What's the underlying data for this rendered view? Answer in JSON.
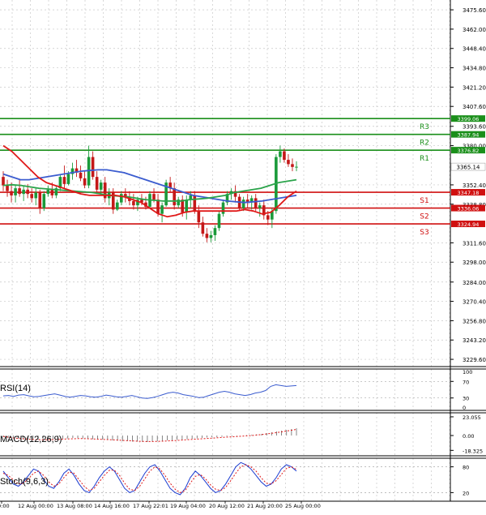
{
  "chart_data": {
    "type": "candlestick",
    "instrument_note": "",
    "main": {
      "ylim": [
        3224.5,
        3482.5
      ],
      "yticks": [
        3475.6,
        3462.0,
        3448.4,
        3434.8,
        3421.2,
        3407.6,
        3393.6,
        3380.0,
        3352.4,
        3338.8,
        3311.6,
        3298.0,
        3284.0,
        3270.4,
        3256.8,
        3243.2,
        3229.6
      ],
      "ytick_labels": [
        "3475.60",
        "3462.00",
        "3448.40",
        "3434.80",
        "3421.20",
        "3407.60",
        "3393.60",
        "3380.00",
        "3352.40",
        "3338.80",
        "3311.60",
        "3298.00",
        "3284.00",
        "3270.40",
        "3256.80",
        "3243.20",
        "3229.60"
      ],
      "levels": [
        {
          "name": "R3",
          "value": 3399.06,
          "label": "3399.06",
          "color": "#1a8f1a"
        },
        {
          "name": "R2",
          "value": 3387.94,
          "label": "3387.94",
          "color": "#1a8f1a"
        },
        {
          "name": "R1",
          "value": 3376.82,
          "label": "3376.82",
          "color": "#1a8f1a"
        },
        {
          "name": "S1",
          "value": 3347.18,
          "label": "3347.18",
          "color": "#d01010"
        },
        {
          "name": "S2",
          "value": 3336.06,
          "label": "3336.06",
          "color": "#d01010"
        },
        {
          "name": "S3",
          "value": 3324.94,
          "label": "3324.94",
          "color": "#d01010"
        }
      ],
      "last_price": {
        "value": 3365.14,
        "label": "3365.14"
      },
      "candles": [
        [
          3358,
          3362,
          3348,
          3352
        ],
        [
          3352,
          3356,
          3344,
          3348
        ],
        [
          3348,
          3354,
          3340,
          3345
        ],
        [
          3345,
          3352,
          3340,
          3350
        ],
        [
          3350,
          3356,
          3344,
          3346
        ],
        [
          3346,
          3352,
          3341,
          3349
        ],
        [
          3349,
          3353,
          3343,
          3346
        ],
        [
          3346,
          3350,
          3340,
          3343
        ],
        [
          3343,
          3350,
          3338,
          3347
        ],
        [
          3347,
          3349,
          3332,
          3336
        ],
        [
          3336,
          3348,
          3334,
          3346
        ],
        [
          3346,
          3352,
          3344,
          3349
        ],
        [
          3349,
          3354,
          3343,
          3345
        ],
        [
          3345,
          3352,
          3343,
          3350
        ],
        [
          3350,
          3360,
          3348,
          3358
        ],
        [
          3358,
          3366,
          3350,
          3353
        ],
        [
          3353,
          3362,
          3352,
          3360
        ],
        [
          3360,
          3368,
          3356,
          3364
        ],
        [
          3364,
          3370,
          3358,
          3361
        ],
        [
          3361,
          3366,
          3355,
          3357
        ],
        [
          3357,
          3362,
          3350,
          3352
        ],
        [
          3352,
          3380,
          3350,
          3372
        ],
        [
          3372,
          3376,
          3356,
          3358
        ],
        [
          3358,
          3362,
          3346,
          3349
        ],
        [
          3349,
          3356,
          3346,
          3354
        ],
        [
          3354,
          3358,
          3340,
          3343
        ],
        [
          3343,
          3350,
          3338,
          3347
        ],
        [
          3347,
          3350,
          3332,
          3335
        ],
        [
          3335,
          3342,
          3334,
          3340
        ],
        [
          3340,
          3348,
          3338,
          3346
        ],
        [
          3346,
          3350,
          3340,
          3344
        ],
        [
          3344,
          3348,
          3338,
          3341
        ],
        [
          3341,
          3346,
          3335,
          3338
        ],
        [
          3338,
          3344,
          3334,
          3342
        ],
        [
          3342,
          3346,
          3338,
          3340
        ],
        [
          3340,
          3344,
          3335,
          3337
        ],
        [
          3337,
          3348,
          3336,
          3346
        ],
        [
          3346,
          3350,
          3340,
          3342
        ],
        [
          3342,
          3346,
          3330,
          3332
        ],
        [
          3332,
          3340,
          3326,
          3338
        ],
        [
          3338,
          3356,
          3337,
          3354
        ],
        [
          3354,
          3358,
          3347,
          3350
        ],
        [
          3350,
          3354,
          3335,
          3338
        ],
        [
          3338,
          3344,
          3336,
          3342
        ],
        [
          3342,
          3345,
          3330,
          3333
        ],
        [
          3333,
          3345,
          3328,
          3342
        ],
        [
          3342,
          3348,
          3336,
          3345
        ],
        [
          3345,
          3348,
          3332,
          3334
        ],
        [
          3334,
          3338,
          3322,
          3326
        ],
        [
          3326,
          3330,
          3316,
          3318
        ],
        [
          3318,
          3322,
          3312,
          3315
        ],
        [
          3315,
          3320,
          3312,
          3317
        ],
        [
          3317,
          3324,
          3313,
          3322
        ],
        [
          3322,
          3334,
          3320,
          3332
        ],
        [
          3332,
          3342,
          3330,
          3340
        ],
        [
          3340,
          3348,
          3338,
          3346
        ],
        [
          3346,
          3350,
          3342,
          3348
        ],
        [
          3348,
          3352,
          3340,
          3344
        ],
        [
          3344,
          3346,
          3334,
          3336
        ],
        [
          3336,
          3344,
          3334,
          3342
        ],
        [
          3342,
          3346,
          3336,
          3340
        ],
        [
          3340,
          3345,
          3335,
          3343
        ],
        [
          3343,
          3346,
          3334,
          3336
        ],
        [
          3336,
          3340,
          3330,
          3338
        ],
        [
          3338,
          3342,
          3328,
          3331
        ],
        [
          3331,
          3334,
          3324,
          3328
        ],
        [
          3328,
          3336,
          3322,
          3334
        ],
        [
          3334,
          3374,
          3332,
          3372
        ],
        [
          3372,
          3380,
          3368,
          3376
        ],
        [
          3376,
          3378,
          3368,
          3370
        ],
        [
          3370,
          3374,
          3365,
          3367
        ],
        [
          3367,
          3371,
          3362,
          3365
        ],
        [
          3365,
          3369,
          3362,
          3365.14
        ]
      ],
      "ma_blue": [
        3360,
        3358,
        3356,
        3356,
        3357,
        3358,
        3359,
        3360,
        3361,
        3362,
        3362.5,
        3363,
        3363,
        3362,
        3361,
        3359,
        3357,
        3355,
        3353,
        3351,
        3349,
        3347,
        3345,
        3344,
        3343,
        3342,
        3341,
        3340.5,
        3340,
        3340.5,
        3341,
        3342,
        3343,
        3344,
        3345
      ],
      "ma_green": [
        3352,
        3352.5,
        3352,
        3351,
        3350,
        3349.5,
        3349,
        3348.5,
        3348,
        3347.5,
        3347,
        3346,
        3345,
        3344.5,
        3344,
        3343,
        3342,
        3341.5,
        3341,
        3341,
        3341,
        3342,
        3342.5,
        3343,
        3344,
        3345,
        3347,
        3348,
        3349,
        3350,
        3352,
        3354,
        3355,
        3356
      ],
      "ma_red": [
        3380,
        3376,
        3370,
        3364,
        3358,
        3354,
        3352,
        3350,
        3348,
        3346,
        3345,
        3345,
        3345,
        3345,
        3344,
        3342,
        3340,
        3336,
        3332,
        3330,
        3331,
        3333,
        3334,
        3334,
        3334,
        3334,
        3334,
        3334,
        3335,
        3334,
        3332,
        3333,
        3338,
        3344,
        3348
      ]
    },
    "xaxis_labels": [
      "0:00",
      "12 Aug 00:00",
      "13 Aug 08:00",
      "14 Aug 16:00",
      "17 Aug 22:01",
      "19 Aug 04:00",
      "20 Aug 12:00",
      "21 Aug 20:00",
      "25 Aug 00:00"
    ],
    "rsi": {
      "label": "RSI(14)",
      "yticks": [
        100,
        70,
        30,
        0
      ],
      "ytick_labels": [
        "100",
        "70",
        "30",
        "0"
      ],
      "values": [
        35,
        36,
        34,
        37,
        38,
        35,
        33,
        34,
        36,
        38,
        40,
        37,
        34,
        32,
        34,
        36,
        35,
        33,
        32,
        34,
        37,
        35,
        33,
        32,
        34,
        36,
        33,
        30,
        29,
        31,
        34,
        38,
        42,
        44,
        42,
        38,
        36,
        34,
        31,
        32,
        36,
        40,
        44,
        46,
        44,
        40,
        38,
        36,
        38,
        42,
        44,
        48,
        58,
        62,
        60,
        58,
        59,
        60
      ]
    },
    "macd": {
      "label": "MACD(12,26,9)",
      "yticks": [
        23.055,
        0.0,
        -18.325
      ],
      "ytick_labels": [
        "23.055",
        "0.00",
        "-18.325"
      ],
      "hist": [
        -2,
        -3,
        -3.5,
        -4,
        -4.5,
        -5,
        -5,
        -5.5,
        -5.5,
        -5,
        -4.5,
        -4,
        -4,
        -3.5,
        -3,
        -3,
        -3.5,
        -4,
        -4.5,
        -5,
        -5,
        -5.5,
        -6,
        -6.5,
        -7,
        -7,
        -7.5,
        -7.5,
        -8,
        -8,
        -7.5,
        -7,
        -6.5,
        -6,
        -6,
        -5.5,
        -5,
        -4.5,
        -4,
        -3.5,
        -3,
        -2.5,
        -2,
        -2,
        -1.5,
        -1,
        -1,
        -0.5,
        0,
        0.5,
        1,
        1.5,
        2,
        3,
        4,
        5,
        6,
        7,
        8,
        9
      ],
      "signal": [
        -1,
        -2,
        -3,
        -3.5,
        -4,
        -4.5,
        -5,
        -5,
        -5.2,
        -5.2,
        -5,
        -4.8,
        -4.5,
        -4.2,
        -4,
        -3.8,
        -3.8,
        -4,
        -4.2,
        -4.5,
        -4.8,
        -5,
        -5.3,
        -5.6,
        -6,
        -6.3,
        -6.6,
        -7,
        -7.2,
        -7.4,
        -7.4,
        -7.2,
        -7,
        -6.7,
        -6.4,
        -6,
        -5.6,
        -5.2,
        -4.8,
        -4.4,
        -4,
        -3.6,
        -3.2,
        -2.8,
        -2.4,
        -2,
        -1.6,
        -1.2,
        -0.8,
        -0.4,
        0,
        0.6,
        1.2,
        2,
        2.8,
        3.6,
        4.5,
        5.5,
        6.5,
        7.5
      ]
    },
    "stoch": {
      "label": "Stoch(9,6,3)",
      "yticks": [
        80,
        20
      ],
      "ytick_labels": [
        "80",
        "20"
      ],
      "k": [
        70,
        55,
        40,
        35,
        45,
        60,
        75,
        70,
        50,
        35,
        30,
        45,
        65,
        75,
        60,
        40,
        25,
        20,
        35,
        55,
        70,
        80,
        70,
        50,
        30,
        20,
        25,
        45,
        65,
        80,
        85,
        70,
        50,
        30,
        20,
        15,
        30,
        55,
        70,
        60,
        45,
        30,
        20,
        25,
        40,
        60,
        80,
        90,
        85,
        75,
        60,
        45,
        35,
        40,
        55,
        75,
        85,
        80,
        70
      ],
      "d": [
        65,
        60,
        50,
        40,
        42,
        52,
        65,
        70,
        60,
        45,
        35,
        40,
        55,
        68,
        65,
        50,
        35,
        25,
        30,
        45,
        60,
        72,
        72,
        60,
        42,
        28,
        25,
        35,
        52,
        70,
        80,
        75,
        60,
        42,
        28,
        20,
        25,
        42,
        58,
        62,
        52,
        38,
        28,
        25,
        32,
        48,
        65,
        80,
        85,
        80,
        70,
        55,
        42,
        40,
        48,
        62,
        76,
        80,
        74
      ]
    }
  }
}
